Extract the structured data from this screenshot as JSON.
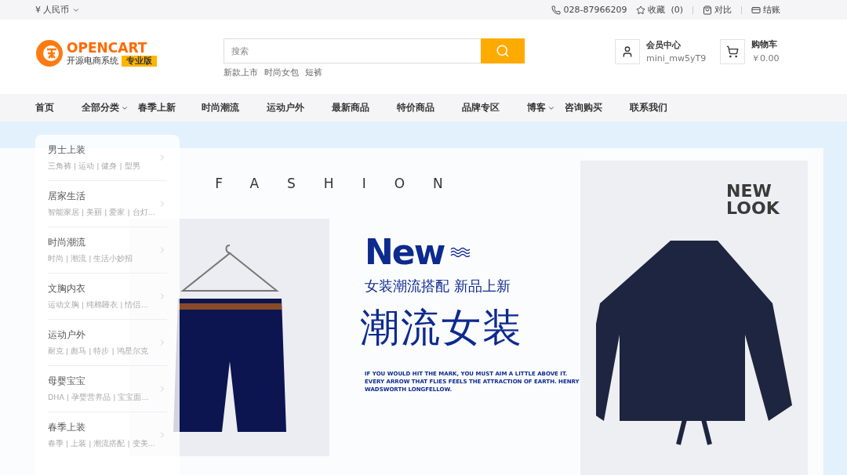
{
  "top_bar": {
    "currency": "¥ 人民币",
    "phone": "028-87966209",
    "links": [
      {
        "kind": "wishlist",
        "label": "收藏",
        "count": "(0)"
      },
      {
        "kind": "compare",
        "label": "对比"
      },
      {
        "kind": "checkout",
        "label": "结账"
      }
    ]
  },
  "logo": {
    "name": "OPENCART",
    "tagline": "开源电商系统",
    "badge": "专业版"
  },
  "search": {
    "placeholder": "搜索",
    "hot_tags": [
      "新款上市",
      "时尚女包",
      "短裤"
    ]
  },
  "account": {
    "title": "会员中心",
    "username": "mini_mw5yT9"
  },
  "cart": {
    "title": "购物车",
    "total": "￥0.00"
  },
  "nav": [
    {
      "label": "首页",
      "dropdown": false
    },
    {
      "label": "全部分类",
      "dropdown": true
    },
    {
      "label": "春季上新",
      "dropdown": false
    },
    {
      "label": "时尚潮流",
      "dropdown": false
    },
    {
      "label": "运动户外",
      "dropdown": false
    },
    {
      "label": "最新商品",
      "dropdown": false
    },
    {
      "label": "特价商品",
      "dropdown": false
    },
    {
      "label": "品牌专区",
      "dropdown": false
    },
    {
      "label": "博客",
      "dropdown": true
    },
    {
      "label": "咨询购买",
      "dropdown": false
    },
    {
      "label": "联系我们",
      "dropdown": false
    }
  ],
  "categories": [
    {
      "title": "男士上装",
      "subs": "三角裤 | 运动 | 健身 | 型男"
    },
    {
      "title": "居家生活",
      "subs": "智能家居 | 美丽 | 爱家 | 台灯..."
    },
    {
      "title": "时尚潮流",
      "subs": "时尚 | 潮流 | 生活小妙招"
    },
    {
      "title": "文胸内衣",
      "subs": "运动文胸 | 纯棉睡衣 | 情侣..."
    },
    {
      "title": "运动户外",
      "subs": "耐克 | 彪马 | 特步 | 鸿星尔克"
    },
    {
      "title": "母婴宝宝",
      "subs": "DHA | 孕婴营养品 | 宝宝面..."
    },
    {
      "title": "春季上装",
      "subs": "春季 | 上装 | 潮流搭配 | 变美..."
    }
  ],
  "banner": {
    "heading": "FASHION",
    "new": "New",
    "subtitle": "女装潮流搭配 新品上新",
    "title": "潮流女装",
    "quote": "IF YOU WOULD HIT THE MARK, YOU MUST AIM A LITTLE ABOVE IT. EVERY ARROW THAT FLIES FEELS THE ATTRACTION OF EARTH.    HENRY WADSWORTH LONGFELLOW.",
    "photo_caption": "NEW LOOK"
  }
}
